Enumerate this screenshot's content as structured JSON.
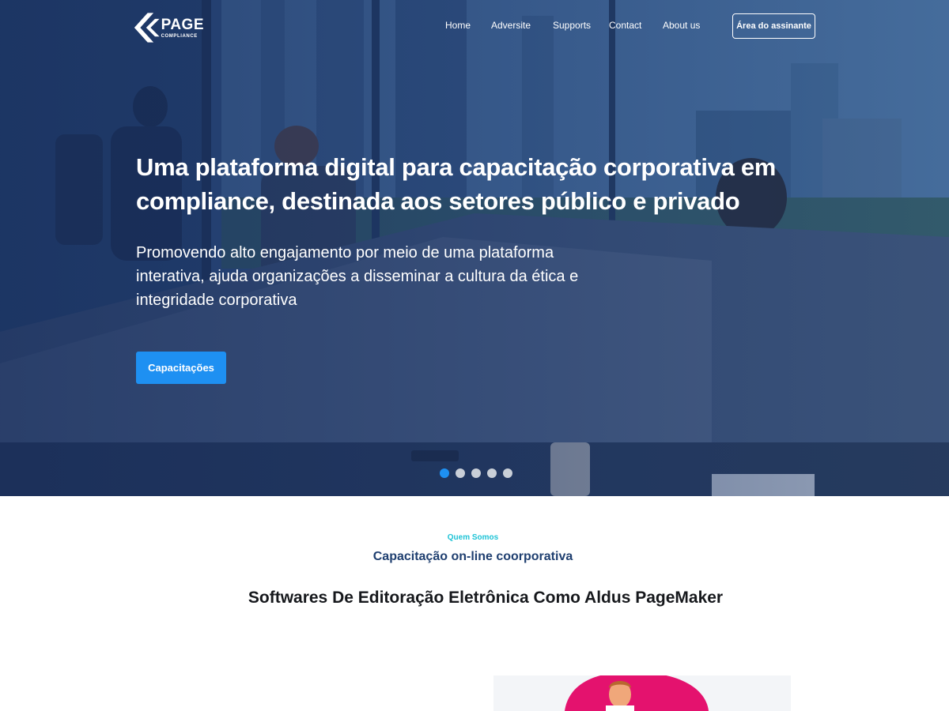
{
  "brand": {
    "name": "PAGE",
    "tagline": "COMPLIANCE"
  },
  "nav": {
    "items": [
      {
        "label": "Home"
      },
      {
        "label": "Adversite"
      },
      {
        "label": "Supports"
      },
      {
        "label": "Contact"
      },
      {
        "label": "About us"
      }
    ],
    "subscriber_button": "Área do assinante"
  },
  "hero": {
    "title": "Uma plataforma digital para capacitação corporativa em compliance, destinada aos setores público e privado",
    "subtitle": "Promovendo alto engajamento por meio de uma plataforma interativa, ajuda organizações a disseminar a cultura da ética e integridade corporativa",
    "cta_label": "Capacitações",
    "slide_count": 5,
    "active_slide": 1
  },
  "about": {
    "eyebrow": "Quem Somos",
    "title": "Capacitação on-line coorporativa",
    "heading": "Softwares De Editoração Eletrônica Como Aldus PageMaker"
  },
  "colors": {
    "accent": "#1e90f2",
    "eyebrow": "#1ec3d6",
    "navy": "#1f3f70",
    "illustration_pink": "#e4126e"
  }
}
